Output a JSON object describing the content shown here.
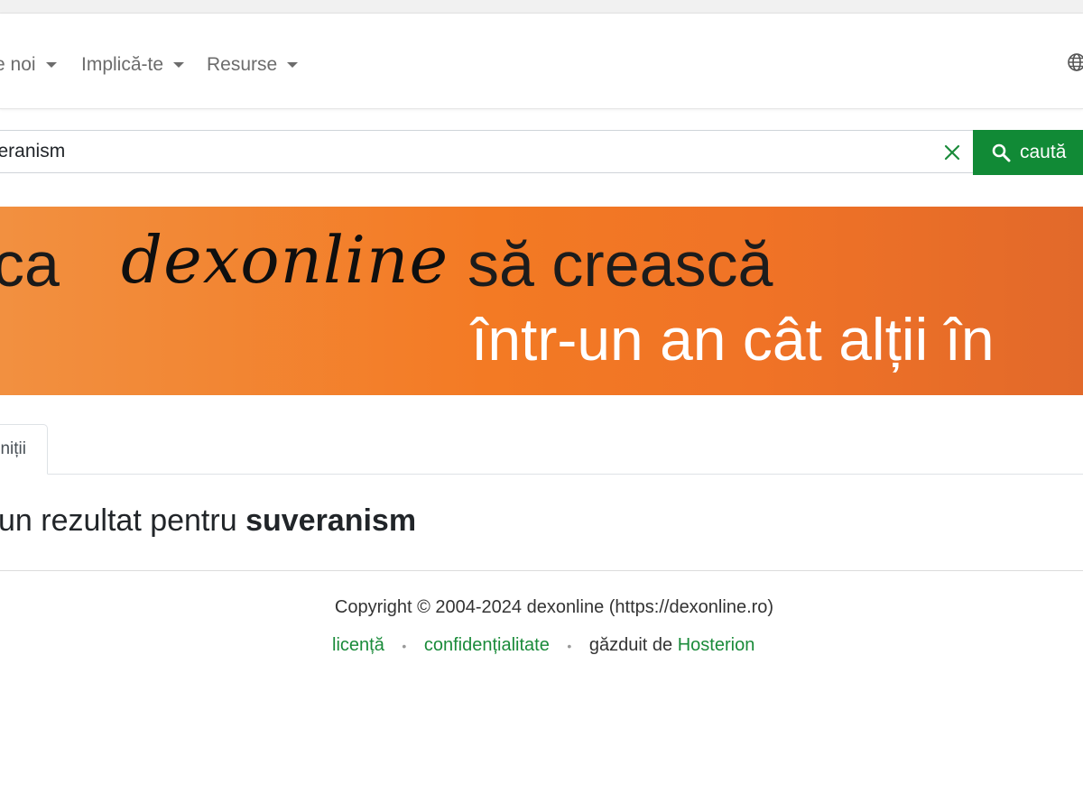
{
  "navbar": {
    "items": [
      {
        "label": "e noi"
      },
      {
        "label": "Implică-te"
      },
      {
        "label": "Resurse"
      }
    ],
    "globe_icon": "globe-icon"
  },
  "search": {
    "value": "veranism",
    "button_label": "caută",
    "button_color": "#118a36",
    "clear_icon": "close-icon",
    "button_icon": "search-icon"
  },
  "banner": {
    "word_ca": "ca",
    "brand": "dexonline",
    "rest_line1": "să crească",
    "line2": "într-un an cât alții în",
    "colors": {
      "start": "#f29040",
      "end": "#e2692a"
    }
  },
  "tabs": [
    {
      "label": "niții"
    }
  ],
  "result": {
    "prefix": "un rezultat pentru",
    "term": "suveranism"
  },
  "footer": {
    "copyright": "Copyright © 2004-2024 dexonline (https://dexonline.ro)",
    "links": [
      {
        "label": "licență"
      },
      {
        "label": "confidențialitate"
      }
    ],
    "hosted_prefix": "găzduit de",
    "hosted_link": "Hosterion",
    "link_color": "#1a8b3a"
  }
}
